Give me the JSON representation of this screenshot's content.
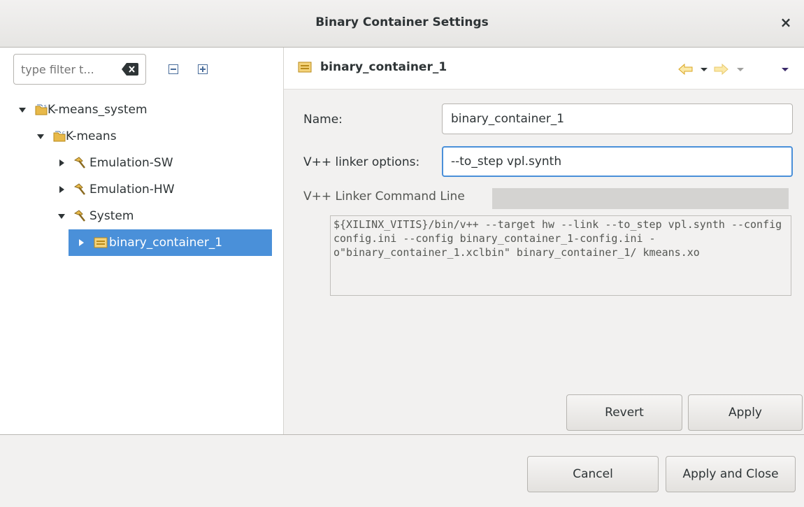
{
  "window": {
    "title": "Binary Container Settings",
    "close_label": "×"
  },
  "left": {
    "filter_placeholder": "type filter t...",
    "tree": [
      {
        "label": "K-means_system",
        "expanded": true,
        "icon": "system-project-icon"
      },
      {
        "label": "K-means",
        "expanded": true,
        "icon": "application-project-icon"
      },
      {
        "label": "Emulation-SW",
        "expanded": false,
        "icon": "build-config-icon"
      },
      {
        "label": "Emulation-HW",
        "expanded": false,
        "icon": "build-config-icon"
      },
      {
        "label": "System",
        "expanded": true,
        "icon": "build-config-icon"
      },
      {
        "label": "binary_container_1",
        "expanded": false,
        "icon": "binary-container-icon",
        "selected": true
      }
    ]
  },
  "page": {
    "title": "binary_container_1",
    "name_label": "Name:",
    "name_value": "binary_container_1",
    "linker_label": "V++ linker options:",
    "linker_value": "--to_step vpl.synth",
    "cmd_label": "V++ Linker Command Line",
    "cmd_text": "${XILINX_VITIS}/bin/v++ --target hw --link --to_step vpl.synth --config config.ini --config binary_container_1-config.ini -o\"binary_container_1.xclbin\" binary_container_1/ kmeans.xo",
    "revert_label": "Revert",
    "apply_label": "Apply"
  },
  "footer": {
    "cancel_label": "Cancel",
    "apply_close_label": "Apply and Close"
  },
  "colors": {
    "selection": "#4a90d9",
    "accent_icon": "#e8b94a"
  }
}
